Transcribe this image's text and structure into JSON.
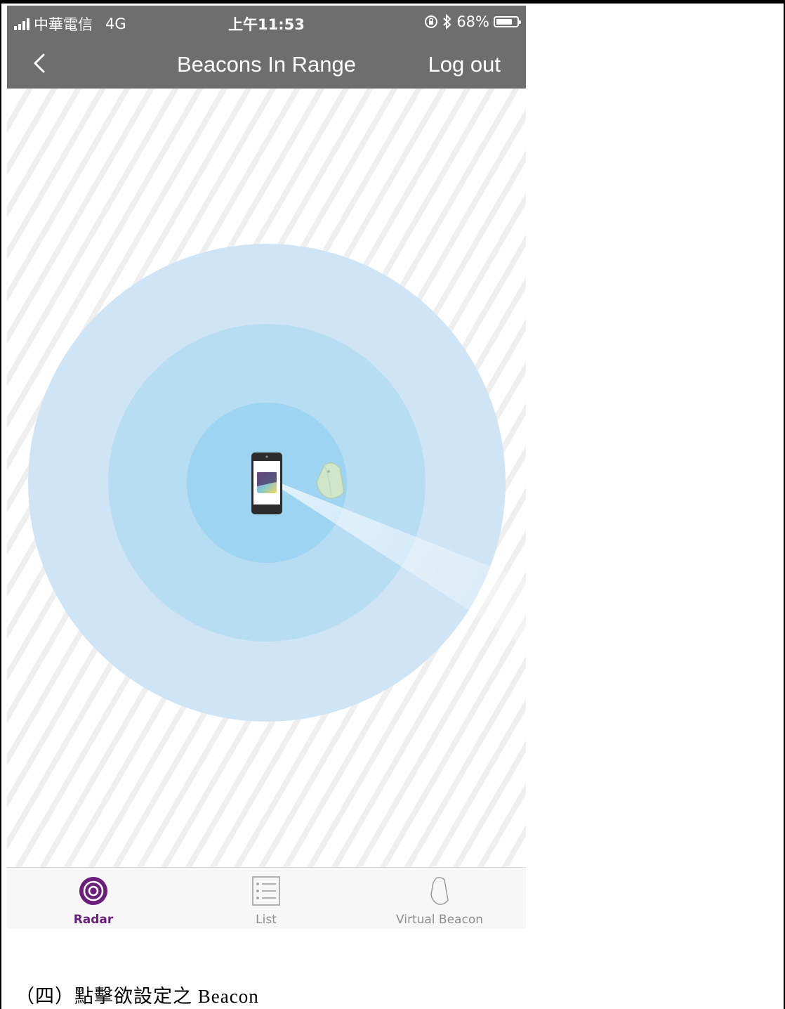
{
  "status_bar": {
    "carrier": "中華電信",
    "network": "4G",
    "time": "上午11:53",
    "battery": "68%",
    "battery_level": 0.68,
    "icons": [
      "signal-icon",
      "orientation-lock-icon",
      "bluetooth-icon",
      "battery-icon"
    ]
  },
  "nav": {
    "back_icon": "chevron-left-icon",
    "title": "Beacons In Range",
    "logout_label": "Log out"
  },
  "radar": {
    "icons": [
      "phone-icon",
      "beacon-icon"
    ],
    "colors": {
      "outer": "#cfe5f5",
      "middle": "#b7ddf3",
      "inner": "#9dd4f2"
    }
  },
  "tabs": [
    {
      "label": "Radar",
      "icon": "radar-icon",
      "active": true
    },
    {
      "label": "List",
      "icon": "list-icon",
      "active": false
    },
    {
      "label": "Virtual Beacon",
      "icon": "virtual-beacon-icon",
      "active": false
    }
  ],
  "accent_color": "#6b1f7b",
  "caption": "（四）點擊欲設定之 Beacon"
}
